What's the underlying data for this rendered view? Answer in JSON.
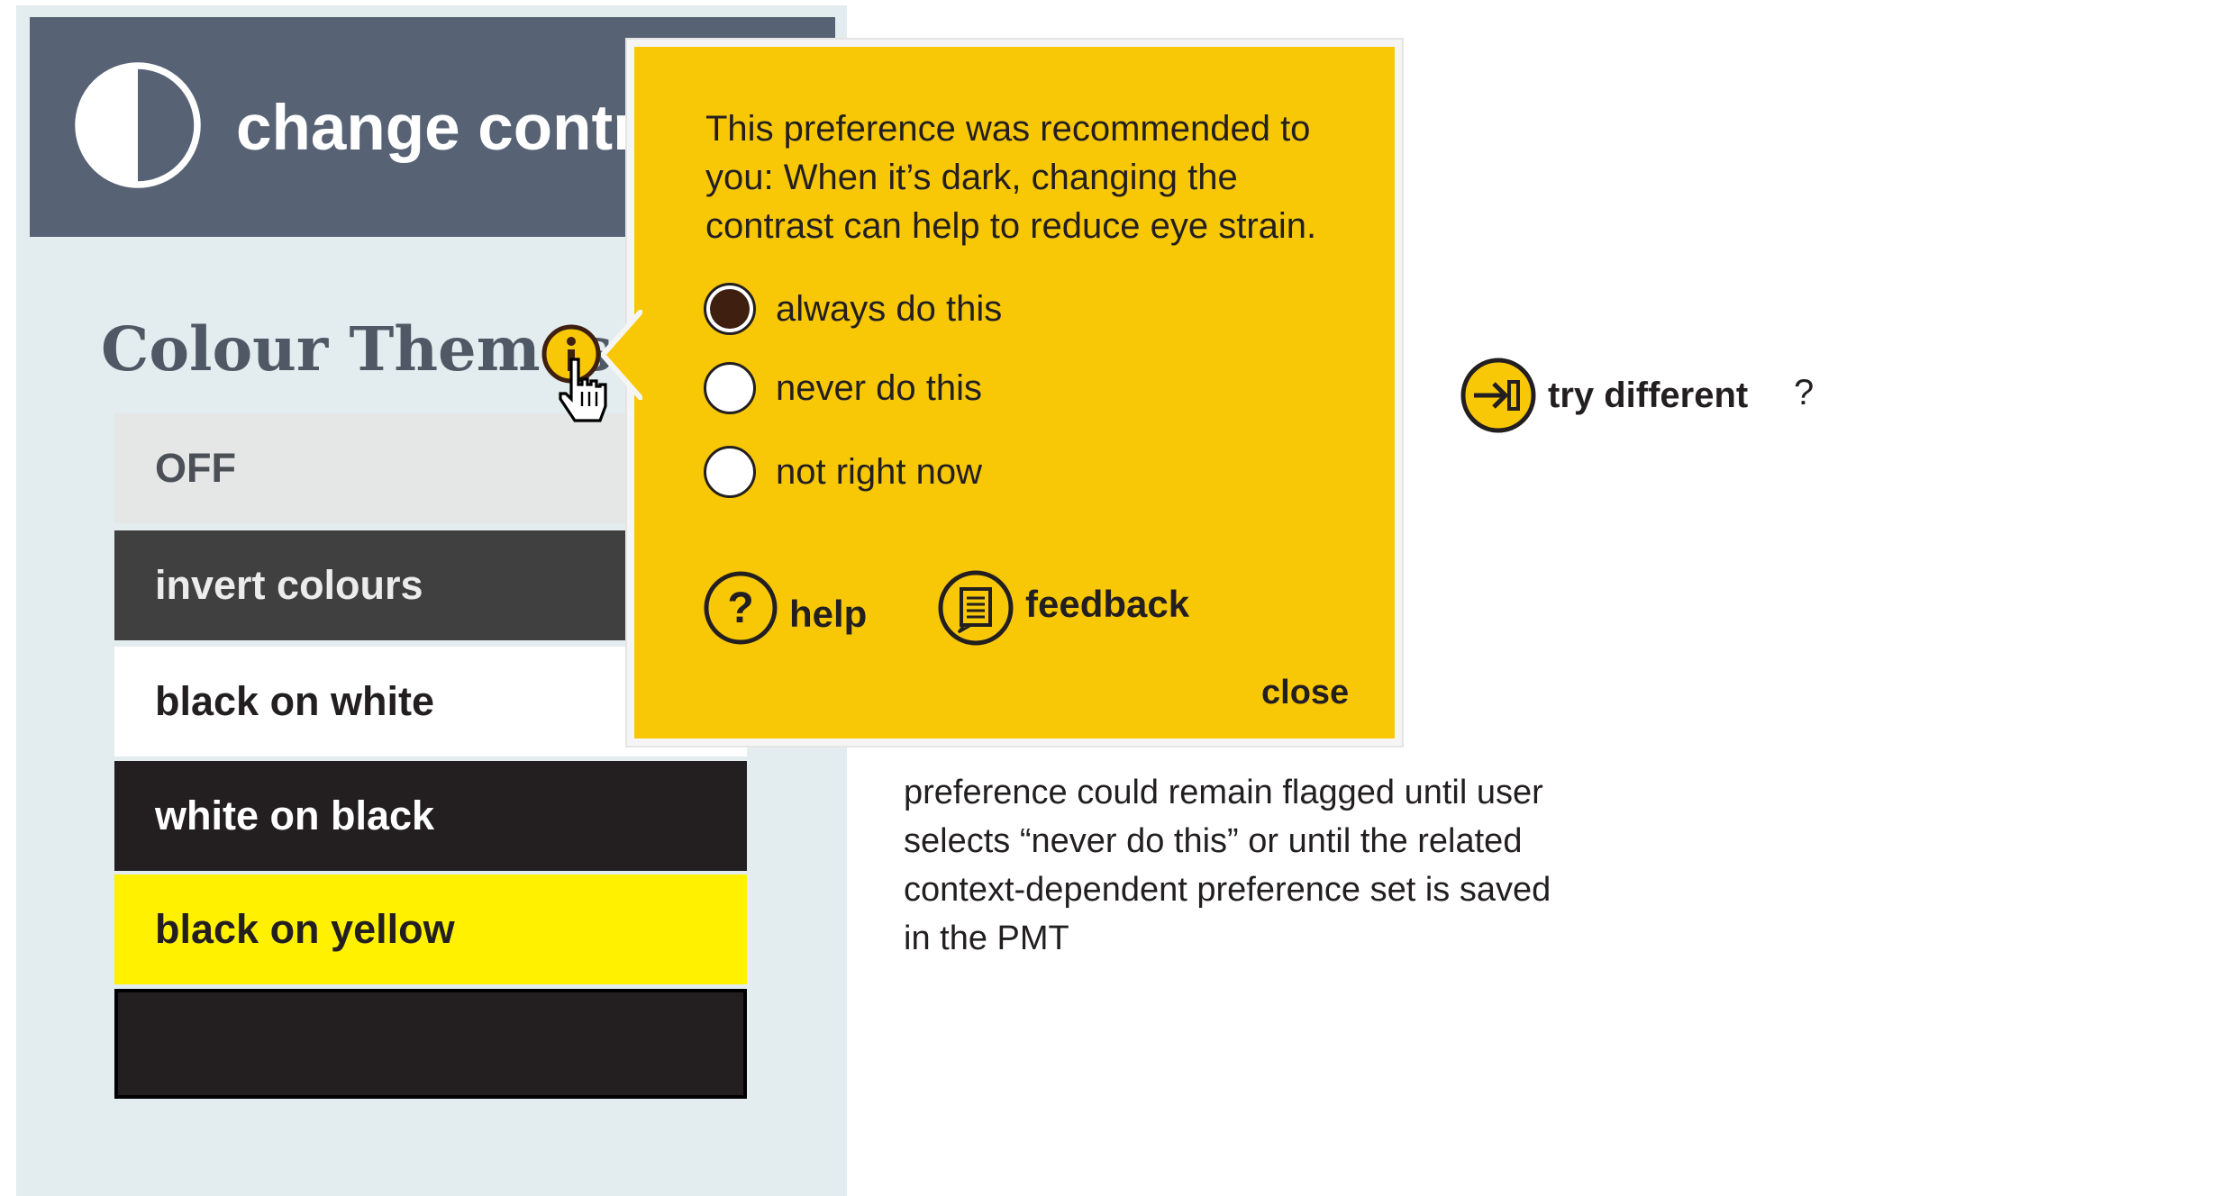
{
  "header": {
    "title": "change contrast",
    "icon": "half-contrast-icon"
  },
  "section": {
    "title": "Colour Themes",
    "info_icon": "info-icon"
  },
  "themes": [
    {
      "label": "OFF"
    },
    {
      "label": "invert colours"
    },
    {
      "label": "black on white"
    },
    {
      "label": "white on black"
    },
    {
      "label": "black on yellow"
    },
    {
      "label": ""
    }
  ],
  "popup": {
    "message": "This preference was recommended to you:  When it’s dark, changing the contrast can help to reduce eye strain.",
    "options": [
      {
        "label": "always do this",
        "selected": true
      },
      {
        "label": "never do this",
        "selected": false
      },
      {
        "label": "not right now",
        "selected": false
      }
    ],
    "help_label": "help",
    "feedback_label": "feedback",
    "close_label": "close",
    "background_color": "#f8c806"
  },
  "try_different": {
    "label": "try different",
    "question": "?"
  },
  "note": "preference could remain flagged until user selects “never do this” or until the related context-dependent preference set is saved in the PMT"
}
